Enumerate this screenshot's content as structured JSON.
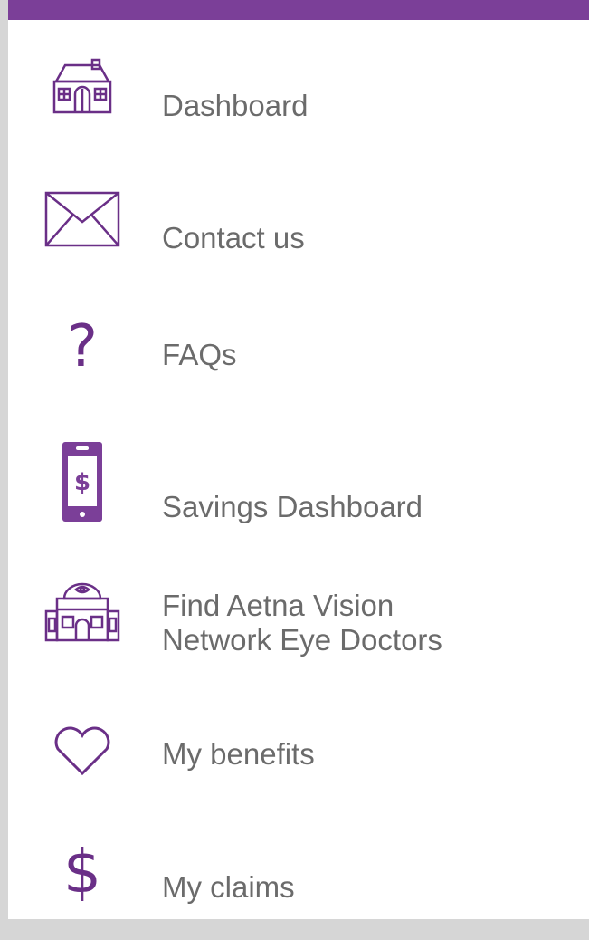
{
  "theme": {
    "accent": "#7b3f98",
    "icon_color": "#6a2f87",
    "label_color": "#6b6b6b"
  },
  "menu": {
    "items": [
      {
        "label": "Dashboard",
        "icon": "house-icon"
      },
      {
        "label": "Contact us",
        "icon": "envelope-icon"
      },
      {
        "label": "FAQs",
        "icon": "question-icon",
        "glyph": "?"
      },
      {
        "label": "Savings Dashboard",
        "icon": "phone-dollar-icon"
      },
      {
        "label": "Find Aetna Vision\nNetwork Eye Doctors",
        "icon": "eye-doctor-building-icon"
      },
      {
        "label": "My benefits",
        "icon": "heart-icon"
      },
      {
        "label": "My claims",
        "icon": "dollar-icon",
        "glyph": "$"
      }
    ]
  }
}
